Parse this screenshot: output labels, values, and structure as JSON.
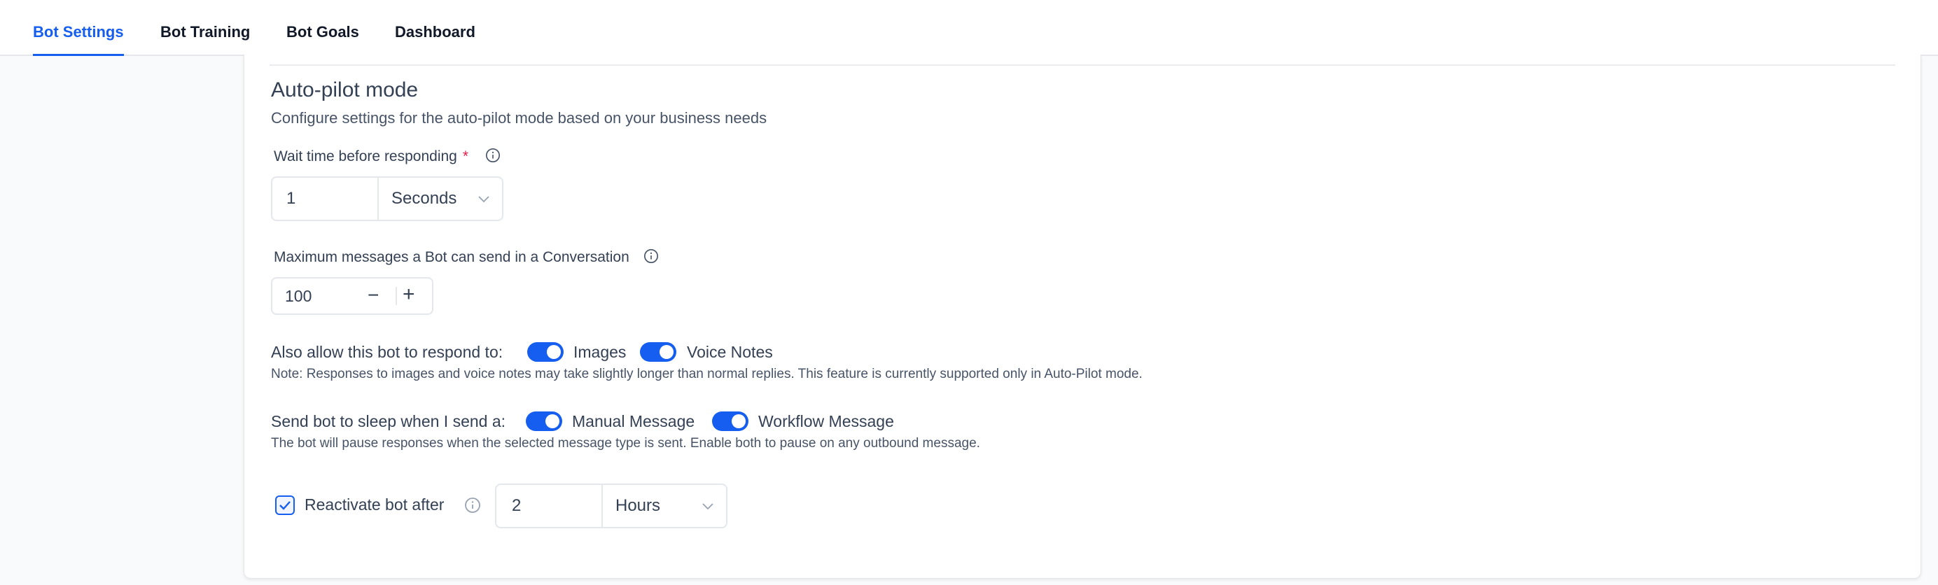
{
  "tabs": [
    {
      "label": "Bot Settings",
      "active": true
    },
    {
      "label": "Bot Training",
      "active": false
    },
    {
      "label": "Bot Goals",
      "active": false
    },
    {
      "label": "Dashboard",
      "active": false
    }
  ],
  "section": {
    "title": "Auto-pilot mode",
    "description": "Configure settings for the auto-pilot mode based on your business needs"
  },
  "wait_time": {
    "label": "Wait time before responding",
    "required_mark": "*",
    "value": "1",
    "unit": "Seconds"
  },
  "max_messages": {
    "label": "Maximum messages a Bot can send in a Conversation",
    "value": "100",
    "decrement": "−",
    "increment": "+"
  },
  "respond_to": {
    "label": "Also allow this bot to respond to:",
    "options": [
      {
        "label": "Images",
        "enabled": true
      },
      {
        "label": "Voice Notes",
        "enabled": true
      }
    ],
    "note": "Note: Responses to images and voice notes may take slightly longer than normal replies. This feature is currently supported only in Auto-Pilot mode."
  },
  "sleep": {
    "label": "Send bot to sleep when I send a:",
    "options": [
      {
        "label": "Manual Message",
        "enabled": true
      },
      {
        "label": "Workflow Message",
        "enabled": true
      }
    ],
    "note": "The bot will pause responses when the selected message type is sent. Enable both to pause on any outbound message."
  },
  "reactivate": {
    "label": "Reactivate bot after",
    "checked": true,
    "value": "2",
    "unit": "Hours"
  },
  "colors": {
    "accent": "#155eef",
    "border": "#e4e7ec",
    "required": "#e11d48"
  }
}
